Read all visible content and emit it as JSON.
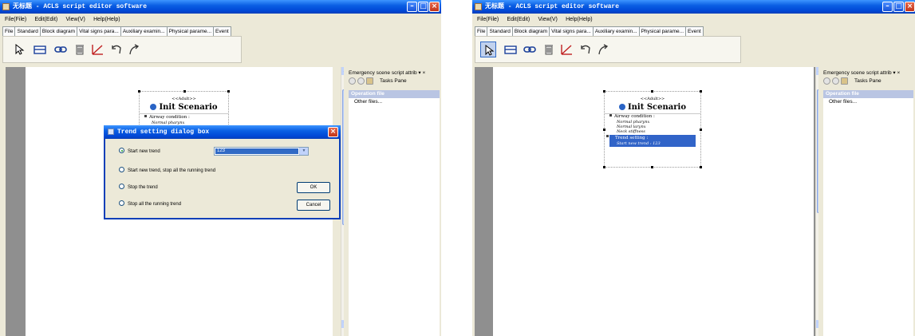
{
  "title": "无标题 - ACLS script editor software",
  "menu": [
    "File(File)",
    "Edit(Edit)",
    "View(V)",
    "Help(Help)"
  ],
  "tabs": [
    "File",
    "Standard",
    "Block diagram",
    "Vital signs para...",
    "Auxiliary examin...",
    "Physical parame...",
    "Event"
  ],
  "toolbar": {
    "tools": [
      "pointer-tool-icon",
      "block-tool-icon",
      "link-tool-icon",
      "delete-tool-icon",
      "trend-tool-icon",
      "undo-tool-icon",
      "redo-tool-icon"
    ]
  },
  "node": {
    "stereotype": "<<Adult>>",
    "title": "Init Scenario",
    "airway_label": "Airway condition :",
    "airway_items": [
      "Normal pharynx",
      "Normal larynx",
      "Neck stiffness"
    ],
    "trend_label": "Trend setting :",
    "trend_value": "Start new trend : 123"
  },
  "taskpane": {
    "header": "Emergency scene script attrib",
    "pane_label": "Tasks Pane",
    "section": "Operation file",
    "item": "Other files..."
  },
  "dialog": {
    "title": "Trend setting dialog box",
    "options": [
      "Start new trend",
      "Start new trend, stop all the running trend",
      "Stop the trend",
      "Stop all the running trend"
    ],
    "selected_option": 0,
    "combo_value": "123",
    "ok": "OK",
    "cancel": "Cancel"
  },
  "colors": {
    "titlebar": "#0a5fe4",
    "selection": "#316ac5",
    "canvas": "#8f8f8f"
  }
}
